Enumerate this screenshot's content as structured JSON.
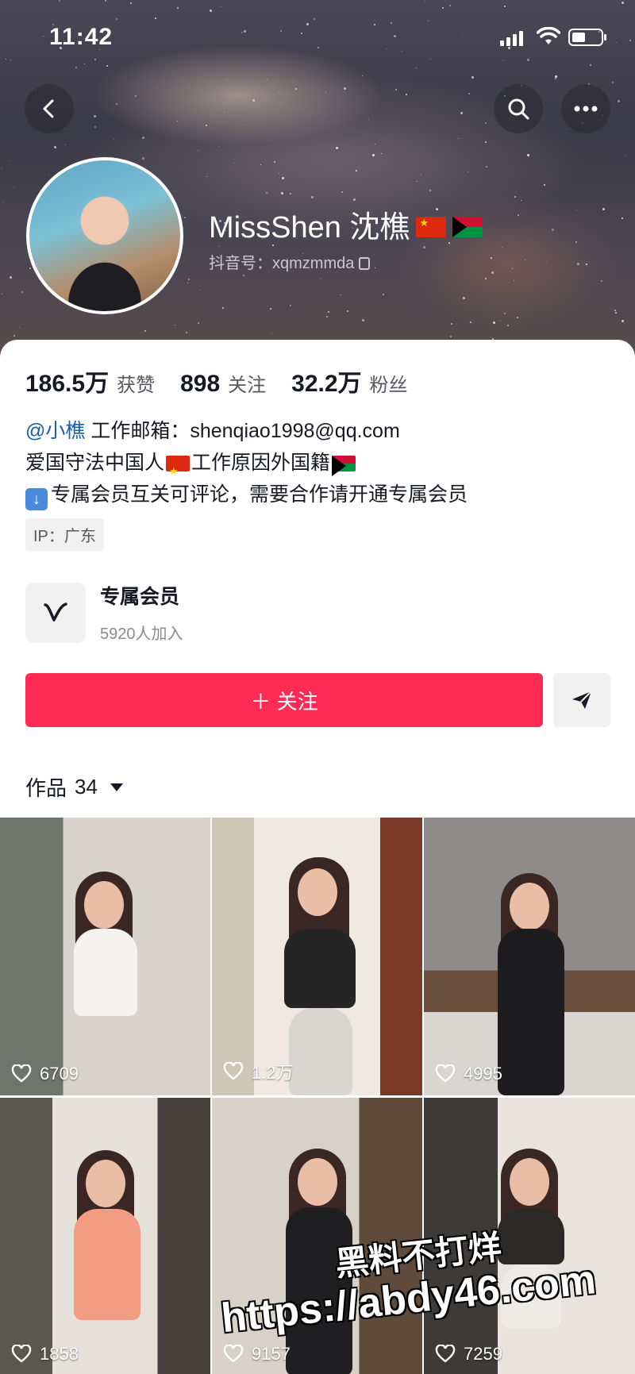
{
  "status_bar": {
    "time": "11:42"
  },
  "profile": {
    "name": "MissShen 沈樵",
    "douyin_id_label": "抖音号：",
    "douyin_id": "xqmzmmda"
  },
  "stats": [
    {
      "value": "186.5万",
      "label": "获赞"
    },
    {
      "value": "898",
      "label": "关注"
    },
    {
      "value": "32.2万",
      "label": "粉丝"
    }
  ],
  "bio": {
    "mention": "@小樵",
    "email_text": " 工作邮箱：shenqiao1998@qq.com",
    "line2_a": "爱国守法中国人",
    "line2_b": "工作原因外国籍",
    "line3": "专属会员互关可评论，需要合作请开通专属会员"
  },
  "ip_tag": "IP：广东",
  "membership": {
    "title": "专属会员",
    "subtitle": "5920人加入"
  },
  "actions": {
    "follow_label": "＋ 关注"
  },
  "works_tab": {
    "label": "作品",
    "count": "34"
  },
  "videos": [
    {
      "likes": "6709"
    },
    {
      "likes": "1.2万"
    },
    {
      "likes": "4995"
    },
    {
      "likes": "1858"
    },
    {
      "likes": "9157"
    },
    {
      "likes": "7259"
    }
  ],
  "watermark": {
    "line1": "黑料不打烊",
    "line2": "https://abdy46.com"
  },
  "colors": {
    "follow_button": "#fe2c55",
    "mention": "#1d5ea8"
  }
}
